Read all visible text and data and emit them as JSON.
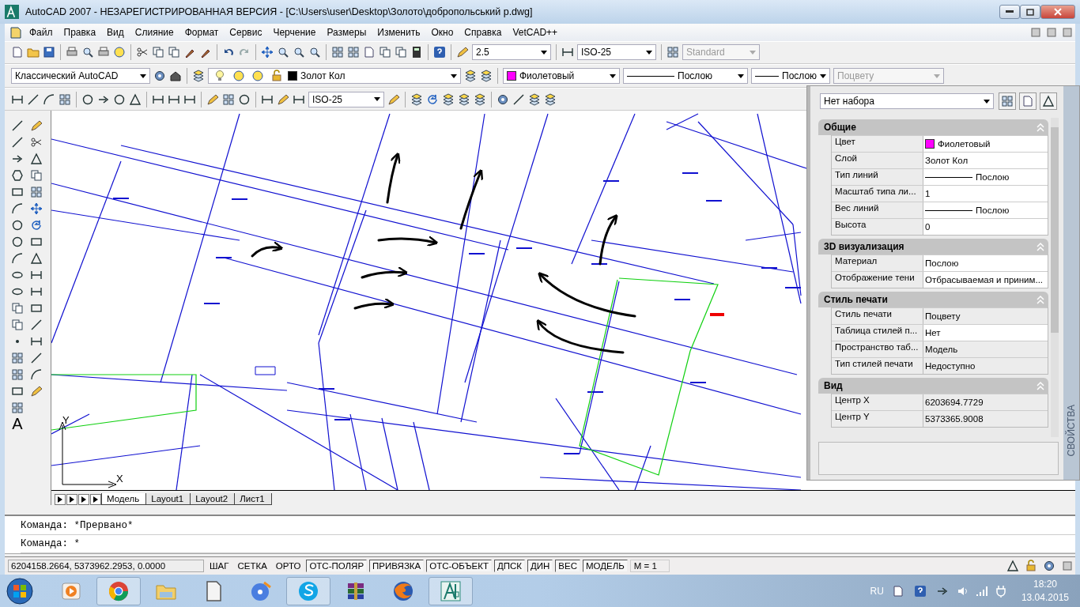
{
  "window": {
    "title": "AutoCAD 2007 - НЕЗАРЕГИСТРИРОВАННАЯ ВЕРСИЯ - [C:\\Users\\user\\Desktop\\Золото\\добропольський р.dwg]"
  },
  "menu": [
    "Файл",
    "Правка",
    "Вид",
    "Слияние",
    "Формат",
    "Сервис",
    "Черчение",
    "Размеры",
    "Изменить",
    "Окно",
    "Справка",
    "VetCAD++"
  ],
  "toolbars": {
    "text_style": "2.5",
    "dim_style": "ISO-25",
    "table_style": "Standard",
    "workspace": "Классический AutoCAD",
    "layer": "Золот Кол",
    "color_label": "Фиолетовый",
    "color": "#ff00ff",
    "linetype": "Послою",
    "lineweight": "Послою",
    "plot_style": "Поцвету",
    "dim_style_2": "ISO-25"
  },
  "left_toolbar": {
    "text_glyph": "A"
  },
  "canvas": {
    "ucs_y": "Y",
    "ucs_x": "X"
  },
  "layout_tabs": [
    {
      "label": "Модель",
      "selected": true
    },
    {
      "label": "Layout1",
      "selected": false
    },
    {
      "label": "Layout2",
      "selected": false
    },
    {
      "label": "Лист1",
      "selected": false
    }
  ],
  "properties": {
    "selection": "Нет набора",
    "side_title": "СВОЙСТВА",
    "sections": [
      {
        "title": "Общие",
        "rows": [
          {
            "name": "Цвет",
            "value": "Фиолетовый",
            "kind": "color",
            "color": "#ff00ff",
            "readonly": false
          },
          {
            "name": "Слой",
            "value": "Золот Кол",
            "kind": "text",
            "readonly": false
          },
          {
            "name": "Тип линий",
            "value": "Послою",
            "kind": "line",
            "readonly": false
          },
          {
            "name": "Масштаб типа ли...",
            "value": "1",
            "kind": "text",
            "readonly": false
          },
          {
            "name": "Вес линий",
            "value": "Послою",
            "kind": "line",
            "readonly": false
          },
          {
            "name": "Высота",
            "value": "0",
            "kind": "text",
            "readonly": false
          }
        ]
      },
      {
        "title": "3D визуализация",
        "rows": [
          {
            "name": "Материал",
            "value": "Послою",
            "kind": "text",
            "readonly": false
          },
          {
            "name": "Отображение тени",
            "value": "Отбрасываемая и приним...",
            "kind": "text",
            "readonly": false
          }
        ]
      },
      {
        "title": "Стиль печати",
        "rows": [
          {
            "name": "Стиль печати",
            "value": "Поцвету",
            "kind": "text",
            "readonly": true
          },
          {
            "name": "Таблица стилей п...",
            "value": "Нет",
            "kind": "text",
            "readonly": false
          },
          {
            "name": "Пространство таб...",
            "value": "Модель",
            "kind": "text",
            "readonly": true
          },
          {
            "name": "Тип стилей печати",
            "value": "Недоступно",
            "kind": "text",
            "readonly": true
          }
        ]
      },
      {
        "title": "Вид",
        "rows": [
          {
            "name": "Центр X",
            "value": "6203694.7729",
            "kind": "text",
            "readonly": true
          },
          {
            "name": "Центр Y",
            "value": "5373365.9008",
            "kind": "text",
            "readonly": true
          }
        ]
      }
    ]
  },
  "command_lines": [
    "Команда: *Прервано*",
    "Команда: *"
  ],
  "status_bar": {
    "coords": "6204158.2664, 5373962.2953, 0.0000",
    "toggles": [
      {
        "label": "ШАГ",
        "on": false
      },
      {
        "label": "СЕТКА",
        "on": false
      },
      {
        "label": "ОРТО",
        "on": false
      },
      {
        "label": "ОТС-ПОЛЯР",
        "on": true
      },
      {
        "label": "ПРИВЯЗКА",
        "on": true
      },
      {
        "label": "ОТС-ОБЪЕКТ",
        "on": true
      },
      {
        "label": "ДПСК",
        "on": true
      },
      {
        "label": "ДИН",
        "on": true
      },
      {
        "label": "ВЕС",
        "on": true
      },
      {
        "label": "МОДЕЛЬ",
        "on": true
      }
    ],
    "scale": "M = 1"
  },
  "taskbar": {
    "apps": [
      {
        "active": false
      },
      {
        "active": true
      },
      {
        "active": false
      },
      {
        "active": false
      },
      {
        "active": false
      },
      {
        "active": true
      },
      {
        "active": false
      },
      {
        "active": false
      },
      {
        "active": true
      }
    ],
    "language": "RU",
    "time": "18:20",
    "date": "13.04.2015"
  }
}
